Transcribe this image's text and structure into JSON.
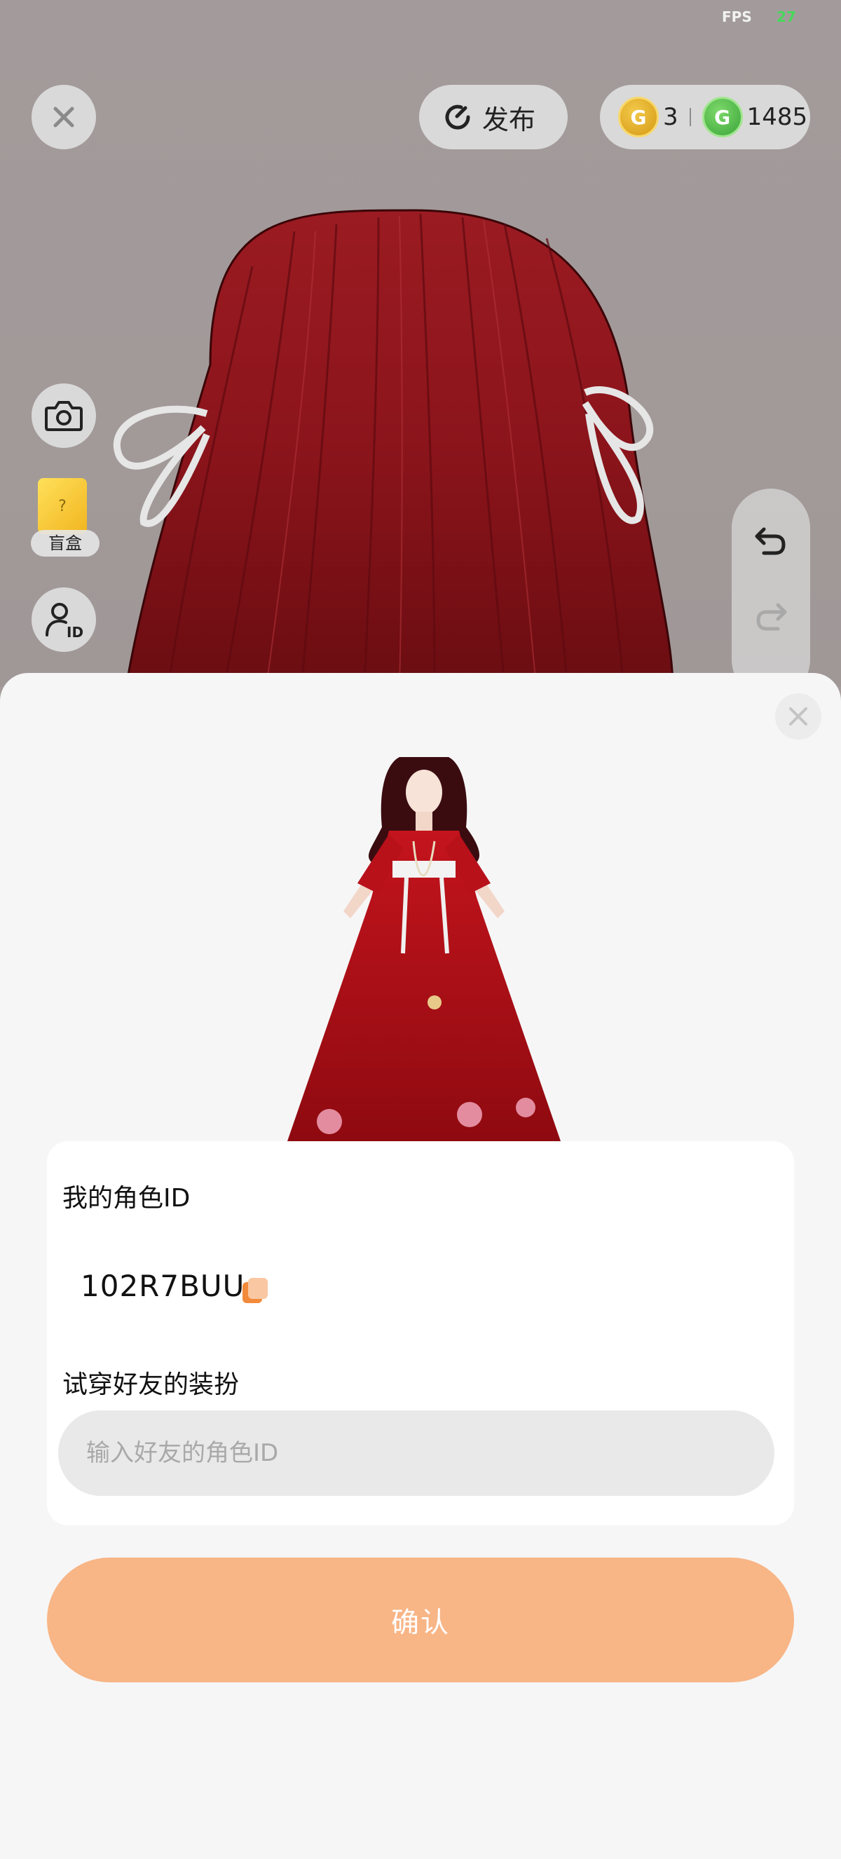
{
  "status": {
    "fps_label": "FPS",
    "fps_value": "27"
  },
  "top_bar": {
    "close_icon": "close-icon",
    "publish_label": "发布",
    "publish_icon": "refresh-circle-icon",
    "gold_coin_value": "3",
    "green_coin_value": "1485"
  },
  "left_tools": {
    "camera_icon": "camera-icon",
    "blind_box_label": "盲盒",
    "blind_box_symbol": "?",
    "role_id_icon": "user-id-icon"
  },
  "right_tools": {
    "undo_icon": "undo-icon",
    "redo_icon": "redo-icon"
  },
  "sheet": {
    "close_icon": "close-icon",
    "my_role_id_label": "我的角色ID",
    "my_role_id": "102R7BUU",
    "try_friend_label": "试穿好友的装扮",
    "friend_id_placeholder": "输入好友的角色ID",
    "confirm_label": "确认"
  },
  "colors": {
    "accent": "#f8b586",
    "fps_green": "#47d85a",
    "sheet_bg": "#f6f6f6",
    "input_bg": "#e9e9e9"
  }
}
